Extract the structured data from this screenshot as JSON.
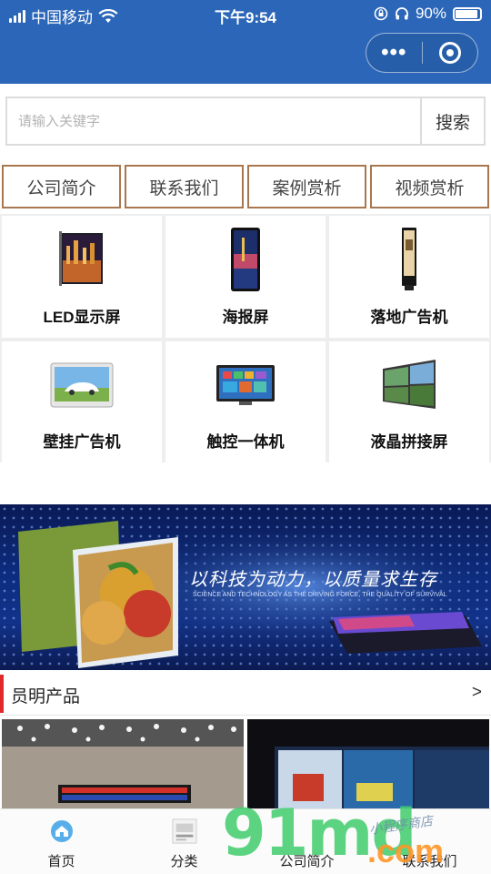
{
  "status_bar": {
    "carrier": "中国移动",
    "time": "下午9:54",
    "battery": "90%"
  },
  "search": {
    "placeholder": "请输入关键字",
    "button": "搜索"
  },
  "quick_links": [
    "公司简介",
    "联系我们",
    "案例赏析",
    "视频赏析"
  ],
  "categories": [
    "LED显示屏",
    "海报屏",
    "落地广告机",
    "壁挂广告机",
    "触控一体机",
    "液晶拼接屏"
  ],
  "banner": {
    "slogan": "以科技为动力，以质量求生存",
    "slogan_en": "SCIENCE AND TECHNOLOGY AS THE DRIVING FORCE, THE QUALITY OF SURVIVAL"
  },
  "section": {
    "title": "员明产品",
    "more": ">"
  },
  "tabs": [
    "首页",
    "分类",
    "公司简介",
    "联系我们"
  ],
  "watermark": {
    "brand": "91md",
    "domain": ".com",
    "shop": "小程序商店"
  },
  "colors": {
    "nav": "#2b66b9",
    "button_border": "#a9774f",
    "section_bar": "#e02a2a"
  }
}
